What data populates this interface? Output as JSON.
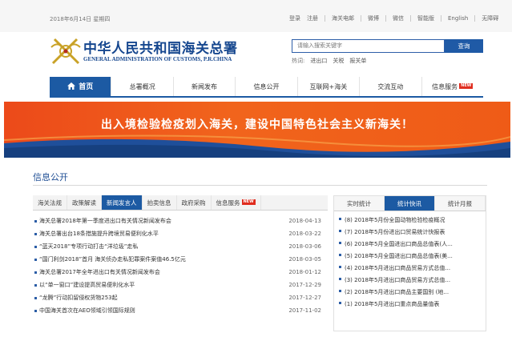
{
  "topbar": {
    "date": "2018年6月14日 星期四",
    "links": [
      "登录",
      "注册",
      "海关电邮",
      "微博",
      "微信",
      "智能版",
      "English",
      "无障碍"
    ]
  },
  "header": {
    "title": "中华人民共和国海关总署",
    "subtitle": "GENERAL ADMINISTRATION OF CUSTOMS, P.R.CHINA"
  },
  "search": {
    "placeholder": "请输入搜索关键字",
    "button": "查询",
    "hot_label": "热词:",
    "hot_words": [
      "进出口",
      "关税",
      "报关单"
    ]
  },
  "nav": {
    "items": [
      {
        "label": "首页",
        "active": true
      },
      {
        "label": "总署概况"
      },
      {
        "label": "新闻发布"
      },
      {
        "label": "信息公开"
      },
      {
        "label": "互联网+海关"
      },
      {
        "label": "交流互动"
      },
      {
        "label": "信息服务",
        "badge": "NEW"
      }
    ]
  },
  "banner": {
    "text": "出入境检验检疫划入海关，建设中国特色社会主义新海关！"
  },
  "section": {
    "title": "信息公开"
  },
  "left_tabs": [
    "海关法规",
    "政策解读",
    "新闻发言人",
    "拍卖信息",
    "政府采购",
    "信息服务",
    "NEW"
  ],
  "left_active_tab": 2,
  "news": [
    {
      "title": "海关总署2018年第一季度进出口有关情况新闻发布会",
      "date": "2018-04-13"
    },
    {
      "title": "海关总署出台18条措施提升跨境贸易便利化水平",
      "date": "2018-03-22"
    },
    {
      "title": "“蓝天2018”专项行动打击“洋垃圾”走私",
      "date": "2018-03-06"
    },
    {
      "title": "“国门利剑2018”首月 海关侦办走私犯罪案件案值46.5亿元",
      "date": "2018-03-05"
    },
    {
      "title": "海关总署2017年全年进出口有关情况新闻发布会",
      "date": "2018-01-12"
    },
    {
      "title": "以“单一窗口”建设提高贸易便利化水平",
      "date": "2017-12-29"
    },
    {
      "title": "“龙腾”行动扣留侵权货物253起",
      "date": "2017-12-27"
    },
    {
      "title": "中国海关首次在AEO领域引领国际规则",
      "date": "2017-11-02"
    }
  ],
  "right_tabs": [
    "实时统计",
    "统计快讯",
    "统计月报"
  ],
  "right_active_tab": 1,
  "stats": [
    "(8) 2018年5月份全国动物检验检疫概况",
    "(7) 2018年5月份进出口贸易统计快报表",
    "(6) 2018年5月全国进出口商品总值表(人...",
    "(5) 2018年5月全国进出口商品总值表(美...",
    "(4) 2018年5月进出口商品贸易方式总值...",
    "(3) 2018年5月进出口商品贸易方式总值...",
    "(2) 2018年5月进出口商品主要国别 (地...",
    "(1) 2018年5月进出口重点商品量值表"
  ],
  "colors": {
    "brand_blue": "#1c5aa3",
    "banner_orange": "#ef5b17",
    "badge_red": "#e02d1f"
  }
}
